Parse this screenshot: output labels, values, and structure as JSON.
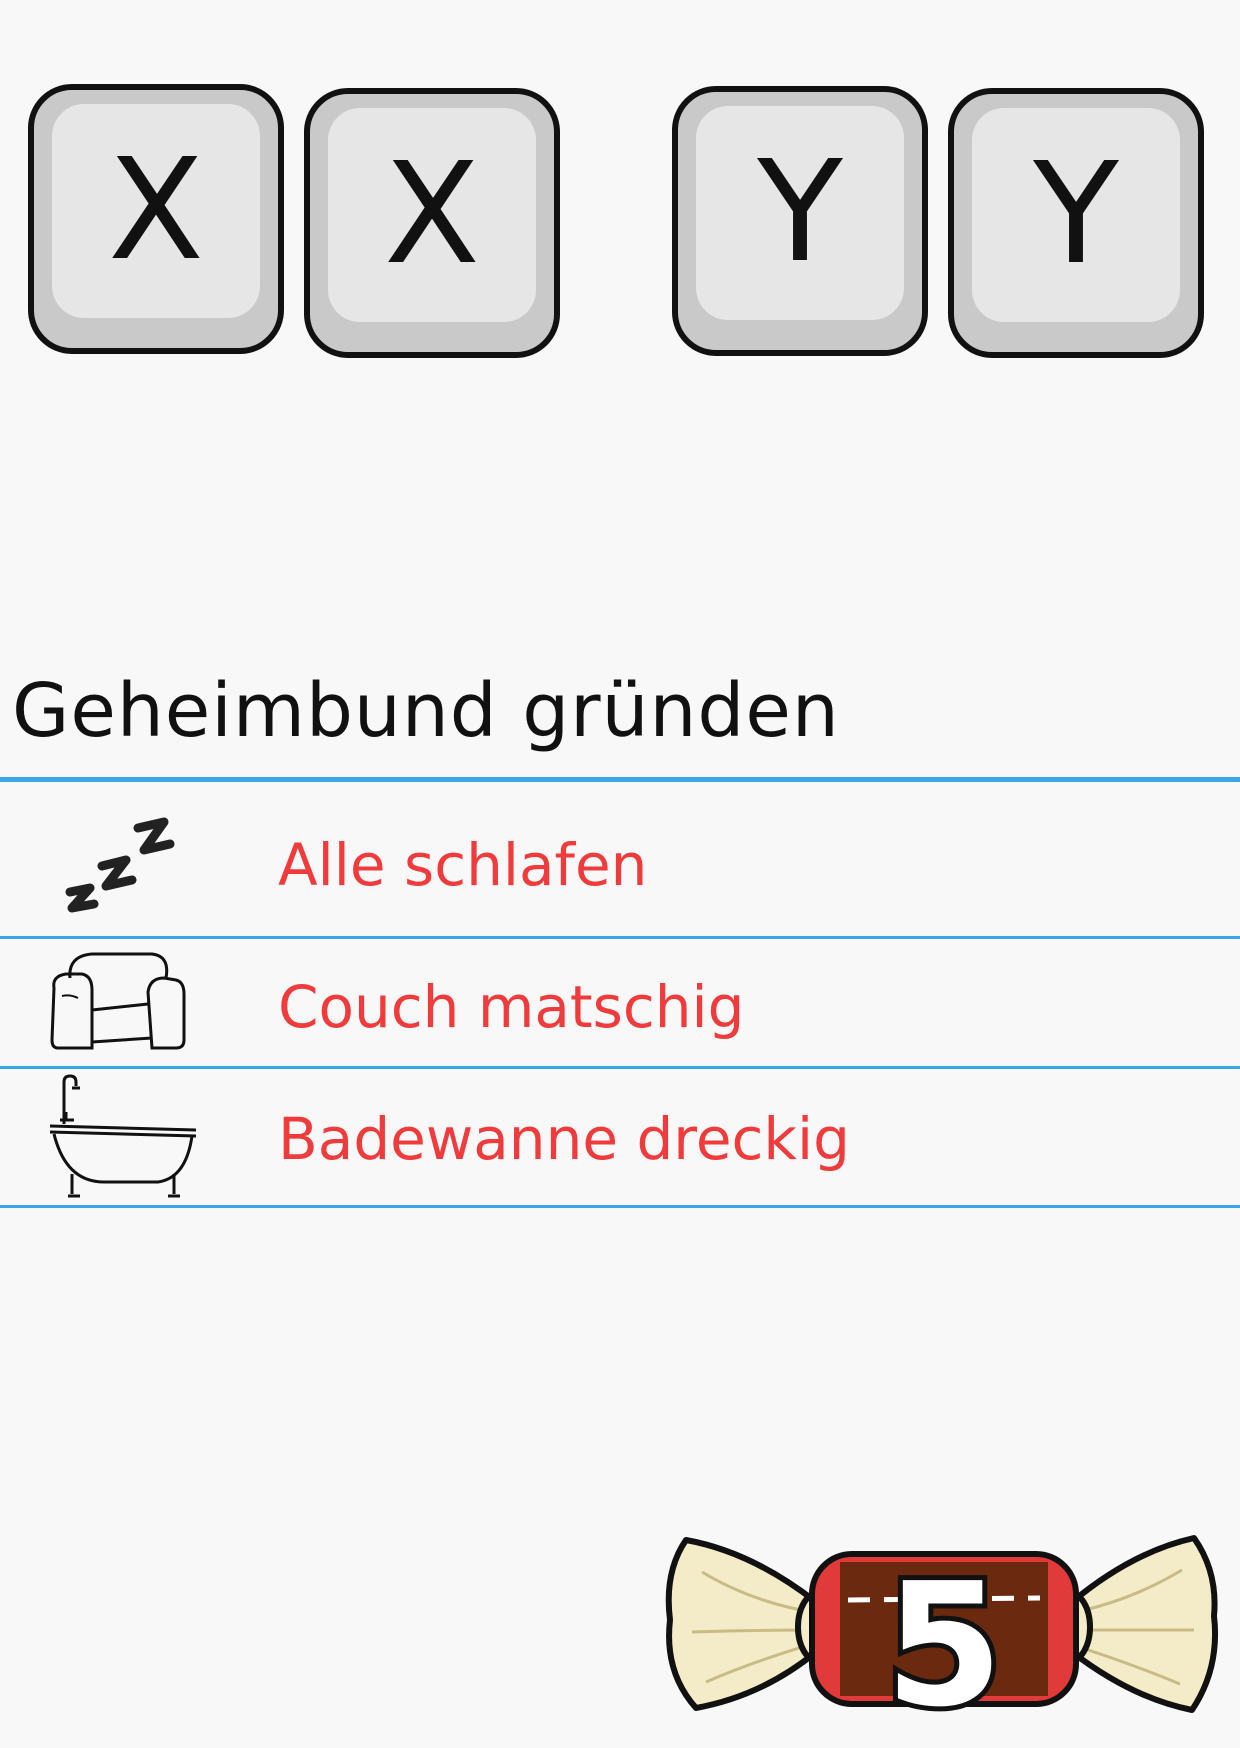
{
  "keys": [
    {
      "letter": "X"
    },
    {
      "letter": "X"
    },
    {
      "letter": "Y"
    },
    {
      "letter": "Y"
    }
  ],
  "title": "Geheimbund gründen",
  "rows": [
    {
      "icon": "sleep-zzz-icon",
      "label": "Alle schlafen"
    },
    {
      "icon": "couch-icon",
      "label": "Couch matschig"
    },
    {
      "icon": "bathtub-icon",
      "label": "Badewanne dreckig"
    }
  ],
  "candy": {
    "value": "5",
    "icon": "candy-icon"
  },
  "colors": {
    "accent_line": "#3aa6e6",
    "row_text": "#ef3b3b",
    "background": "#f8f8f8"
  }
}
